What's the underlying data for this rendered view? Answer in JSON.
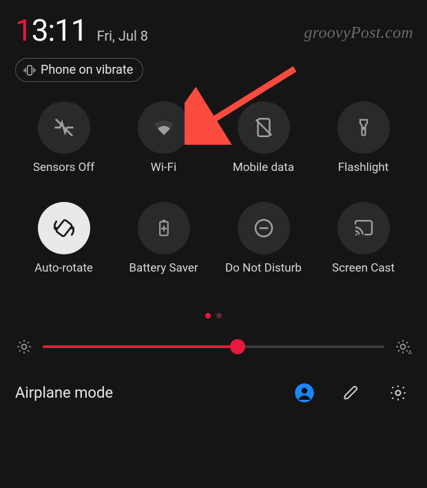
{
  "watermark": "groovyPost.com",
  "time": {
    "h_first": "1",
    "rest": "3:11"
  },
  "date": "Fri, Jul 8",
  "chip": {
    "label": "Phone on vibrate"
  },
  "tiles": [
    {
      "name": "sensors-off",
      "label": "Sensors Off",
      "icon": "sensors-off-icon",
      "active": false
    },
    {
      "name": "wifi",
      "label": "Wi-Fi",
      "icon": "wifi-icon",
      "active": false
    },
    {
      "name": "mobile-data",
      "label": "Mobile data",
      "icon": "mobile-data-icon",
      "active": false
    },
    {
      "name": "flashlight",
      "label": "Flashlight",
      "icon": "flashlight-icon",
      "active": false
    },
    {
      "name": "auto-rotate",
      "label": "Auto-rotate",
      "icon": "auto-rotate-icon",
      "active": true
    },
    {
      "name": "battery-saver",
      "label": "Battery Saver",
      "icon": "battery-saver-icon",
      "active": false
    },
    {
      "name": "dnd",
      "label": "Do Not Disturb",
      "icon": "dnd-icon",
      "active": false
    },
    {
      "name": "screen-cast",
      "label": "Screen Cast",
      "icon": "cast-icon",
      "active": false
    }
  ],
  "pager": {
    "count": 2,
    "active": 0
  },
  "brightness": {
    "value": 0.57,
    "accent": "#e8193c"
  },
  "bottom": {
    "label": "Airplane mode"
  },
  "colors": {
    "accent": "#e8193c",
    "user_accent": "#1a87ff"
  },
  "annotation_arrow": {
    "points_to": "wifi"
  }
}
